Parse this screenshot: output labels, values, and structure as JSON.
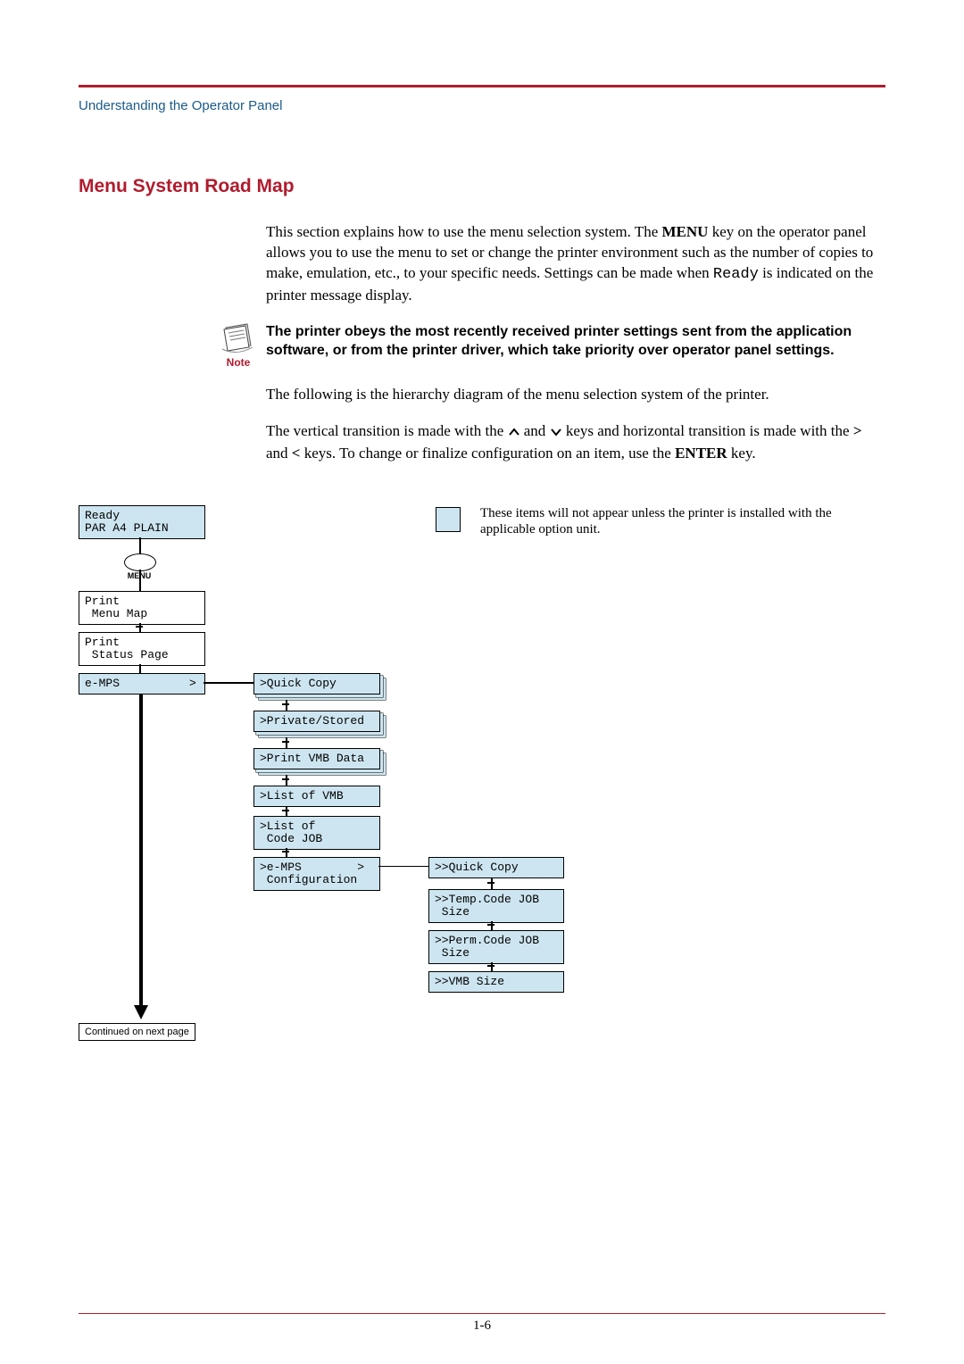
{
  "header": {
    "section": "Understanding the Operator Panel"
  },
  "title": "Menu System Road Map",
  "paragraphs": {
    "p1a": "This section explains how to use the menu selection system. The ",
    "p1_menu": "MENU",
    "p1b": " key on the operator panel allows you to use the menu to set or change the printer environment such as the number of copies to make, emulation, etc., to your specific needs. Settings can be made when ",
    "p1_ready": "Ready",
    "p1c": " is indicated on the printer message display.",
    "note_label": "Note",
    "note": "The printer obeys the most recently received printer settings sent from the application software, or from the printer driver, which take priority over operator panel settings.",
    "p2": "The following is the hierarchy diagram of the menu selection system of the printer.",
    "p3a": "The vertical transition is made with the ",
    "p3b": " and ",
    "p3c": " keys and horizontal transition is made with the ",
    "p3_gt": ">",
    "p3d": " and ",
    "p3_lt": "<",
    "p3e": " keys. To change or finalize configuration on an item, use the ",
    "p3_enter": "ENTER",
    "p3f": " key."
  },
  "legend": "These items will not appear unless the printer is installed with the applicable option unit.",
  "diagram": {
    "ready": "Ready\nPAR A4 PLAIN",
    "menu_button": "MENU",
    "col1": {
      "print_menu_map": "Print\n Menu Map",
      "print_status": "Print\n Status Page",
      "emps": "e-MPS          >"
    },
    "col2": {
      "quick_copy": ">Quick Copy",
      "private": ">Private/Stored",
      "print_vmb": ">Print VMB Data",
      "list_vmb": ">List of VMB",
      "list_code": ">List of\n Code JOB",
      "emps_conf": ">e-MPS        >\n Configuration"
    },
    "col3": {
      "quick_copy2": ">>Quick Copy",
      "temp_code": ">>Temp.Code JOB\n Size",
      "perm_code": ">>Perm.Code JOB\n Size",
      "vmb_size": ">>VMB Size"
    },
    "continued": "Continued on next page"
  },
  "footer": {
    "page_number": "1-6"
  }
}
